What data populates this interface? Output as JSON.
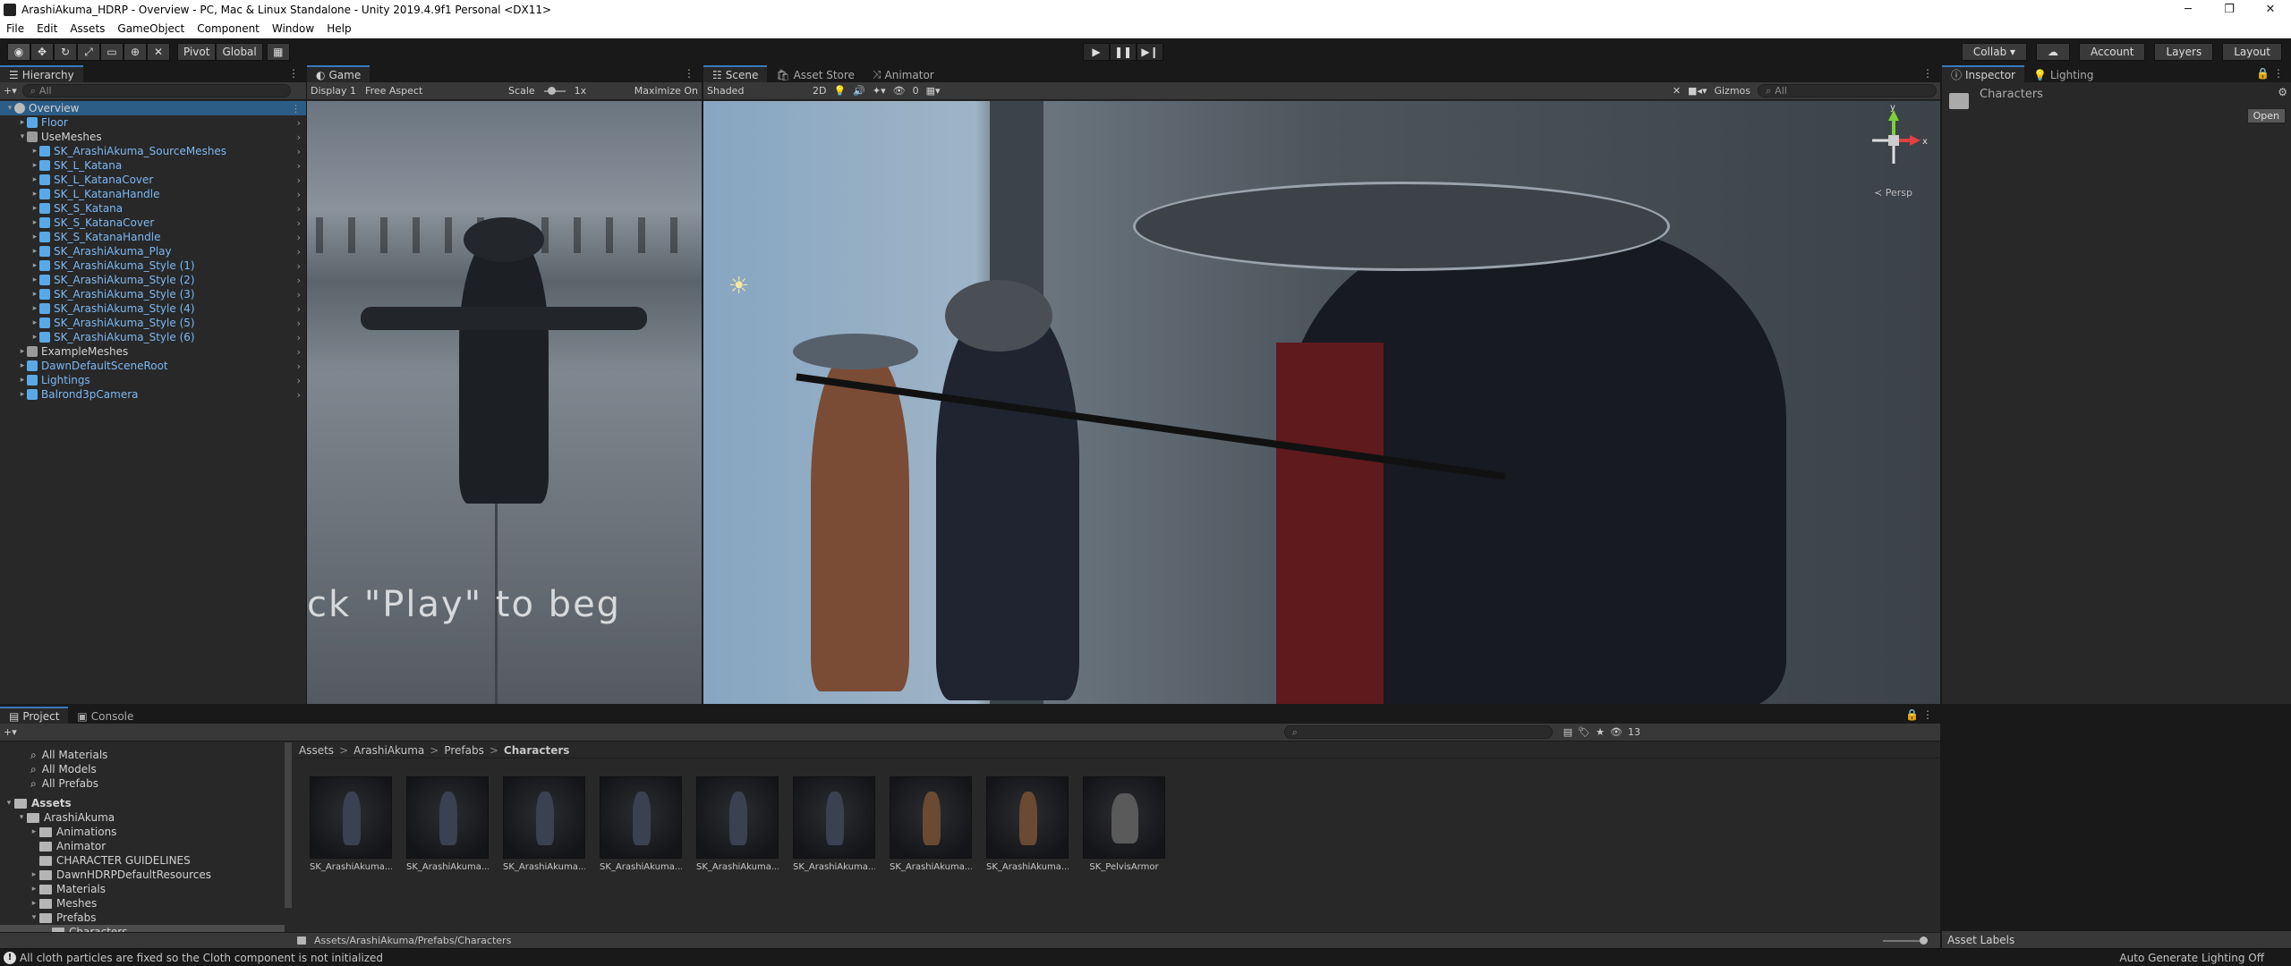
{
  "window": {
    "title": "ArashiAkuma_HDRP - Overview - PC, Mac & Linux Standalone - Unity 2019.4.9f1 Personal <DX11>",
    "controls": [
      "─",
      "❐",
      "✕"
    ]
  },
  "menu": [
    "File",
    "Edit",
    "Assets",
    "GameObject",
    "Component",
    "Window",
    "Help"
  ],
  "toolbar": {
    "pivot": "Pivot",
    "global": "Global",
    "collab": "Collab ▾",
    "account": "Account",
    "layers": "Layers",
    "layout": "Layout"
  },
  "hierarchy": {
    "tab": "Hierarchy",
    "search_placeholder": "All",
    "rows": [
      {
        "label": "Overview",
        "indent": 0,
        "type": "scene",
        "expanded": true
      },
      {
        "label": "Floor",
        "indent": 1,
        "type": "blue",
        "expanded": false
      },
      {
        "label": "UseMeshes",
        "indent": 1,
        "type": "grey",
        "expanded": true
      },
      {
        "label": "SK_ArashiAkuma_SourceMeshes",
        "indent": 2,
        "type": "blue"
      },
      {
        "label": "SK_L_Katana",
        "indent": 2,
        "type": "blue"
      },
      {
        "label": "SK_L_KatanaCover",
        "indent": 2,
        "type": "blue"
      },
      {
        "label": "SK_L_KatanaHandle",
        "indent": 2,
        "type": "blue"
      },
      {
        "label": "SK_S_Katana",
        "indent": 2,
        "type": "blue"
      },
      {
        "label": "SK_S_KatanaCover",
        "indent": 2,
        "type": "blue"
      },
      {
        "label": "SK_S_KatanaHandle",
        "indent": 2,
        "type": "blue"
      },
      {
        "label": "SK_ArashiAkuma_Play",
        "indent": 2,
        "type": "blue"
      },
      {
        "label": "SK_ArashiAkuma_Style (1)",
        "indent": 2,
        "type": "blue"
      },
      {
        "label": "SK_ArashiAkuma_Style (2)",
        "indent": 2,
        "type": "blue"
      },
      {
        "label": "SK_ArashiAkuma_Style (3)",
        "indent": 2,
        "type": "blue"
      },
      {
        "label": "SK_ArashiAkuma_Style (4)",
        "indent": 2,
        "type": "blue"
      },
      {
        "label": "SK_ArashiAkuma_Style (5)",
        "indent": 2,
        "type": "blue"
      },
      {
        "label": "SK_ArashiAkuma_Style (6)",
        "indent": 2,
        "type": "blue"
      },
      {
        "label": "ExampleMeshes",
        "indent": 1,
        "type": "grey"
      },
      {
        "label": "DawnDefaultSceneRoot",
        "indent": 1,
        "type": "blue"
      },
      {
        "label": "Lightings",
        "indent": 1,
        "type": "blue"
      },
      {
        "label": "Balrond3pCamera",
        "indent": 1,
        "type": "blue"
      }
    ]
  },
  "game": {
    "tab": "Game",
    "display": "Display 1",
    "aspect": "Free Aspect",
    "scale_label": "Scale",
    "scale_value": "1x",
    "maximize": "Maximize On",
    "overlay_text": "ck \"Play\" to beg"
  },
  "scene": {
    "tabs": [
      "Scene",
      "Asset Store",
      "Animator"
    ],
    "shading": "Shaded",
    "mode_2d": "2D",
    "fx_count": "0",
    "gizmos": "Gizmos",
    "search_placeholder": "All",
    "persp": "Persp",
    "axis_y": "y",
    "axis_x": "x"
  },
  "inspector": {
    "tabs": [
      "Inspector",
      "Lighting"
    ],
    "asset_name": "Characters",
    "open": "Open",
    "asset_labels": "Asset Labels"
  },
  "project": {
    "tabs": [
      "Project",
      "Console"
    ],
    "favorites": [
      "All Materials",
      "All Models",
      "All Prefabs"
    ],
    "tree": [
      {
        "label": "Assets",
        "indent": 0,
        "arrow": "▾"
      },
      {
        "label": "ArashiAkuma",
        "indent": 1,
        "arrow": "▾"
      },
      {
        "label": "Animations",
        "indent": 2,
        "arrow": "▸"
      },
      {
        "label": "Animator",
        "indent": 2,
        "arrow": ""
      },
      {
        "label": "CHARACTER GUIDELINES",
        "indent": 2,
        "arrow": ""
      },
      {
        "label": "DawnHDRPDefaultResources",
        "indent": 2,
        "arrow": "▸"
      },
      {
        "label": "Materials",
        "indent": 2,
        "arrow": "▸"
      },
      {
        "label": "Meshes",
        "indent": 2,
        "arrow": "▸"
      },
      {
        "label": "Prefabs",
        "indent": 2,
        "arrow": "▾"
      },
      {
        "label": "Characters",
        "indent": 3,
        "arrow": "",
        "selected": true
      }
    ],
    "breadcrumb": [
      "Assets",
      "ArashiAkuma",
      "Prefabs",
      "Characters"
    ],
    "breadcrumb_sep": ">",
    "assets": [
      "SK_ArashiAkuma...",
      "SK_ArashiAkuma...",
      "SK_ArashiAkuma...",
      "SK_ArashiAkuma...",
      "SK_ArashiAkuma...",
      "SK_ArashiAkuma...",
      "SK_ArashiAkuma...",
      "SK_ArashiAkuma...",
      "SK_PelvisArmor"
    ],
    "path": "Assets/ArashiAkuma/Prefabs/Characters",
    "hidden_count": "13"
  },
  "status": {
    "message": "All cloth particles are fixed so the Cloth component is not initialized",
    "right": "Auto Generate Lighting Off"
  }
}
